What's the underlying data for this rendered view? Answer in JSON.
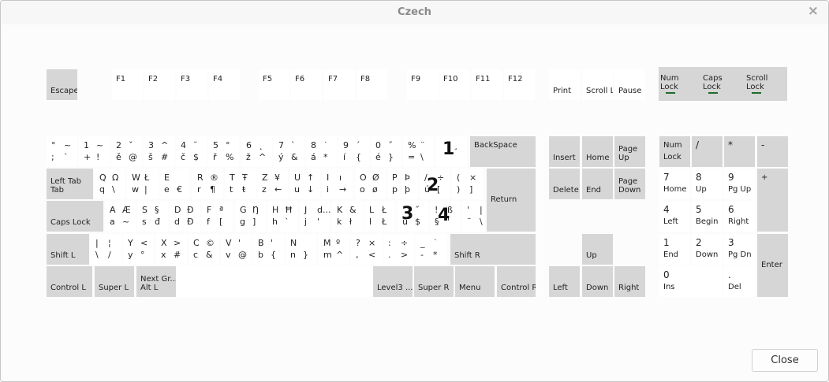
{
  "window": {
    "title": "Czech",
    "close_icon": "×",
    "close_button": "Close"
  },
  "overlay_markers": [
    "1",
    "2",
    "3",
    "4"
  ],
  "keys": [
    {
      "id": "escape",
      "label": "Escape",
      "mod": true
    },
    {
      "id": "f1",
      "label": "F1"
    },
    {
      "id": "f2",
      "label": "F2"
    },
    {
      "id": "f3",
      "label": "F3"
    },
    {
      "id": "f4",
      "label": "F4"
    },
    {
      "id": "f5",
      "label": "F5"
    },
    {
      "id": "f6",
      "label": "F6"
    },
    {
      "id": "f7",
      "label": "F7"
    },
    {
      "id": "f8",
      "label": "F8"
    },
    {
      "id": "f9",
      "label": "F9"
    },
    {
      "id": "f10",
      "label": "F10"
    },
    {
      "id": "f11",
      "label": "F11"
    },
    {
      "id": "f12",
      "label": "F12"
    },
    {
      "id": "print",
      "label": "Print"
    },
    {
      "id": "scroll-lock",
      "label": "Scroll Lock"
    },
    {
      "id": "pause",
      "label": "Pause"
    },
    {
      "id": "grave",
      "sym": [
        "°",
        "~",
        ";",
        "`"
      ]
    },
    {
      "id": "digit-1",
      "sym": [
        "1",
        "~",
        "+",
        "!"
      ]
    },
    {
      "id": "digit-2",
      "sym": [
        "2",
        "ˇ",
        "ě",
        "@"
      ]
    },
    {
      "id": "digit-3",
      "sym": [
        "3",
        "^",
        "š",
        "#"
      ]
    },
    {
      "id": "digit-4",
      "sym": [
        "4",
        "˘",
        "č",
        "$"
      ]
    },
    {
      "id": "digit-5",
      "sym": [
        "5",
        "°",
        "ř",
        "%"
      ]
    },
    {
      "id": "digit-6",
      "sym": [
        "6",
        "˛",
        "ž",
        "^"
      ]
    },
    {
      "id": "digit-7",
      "sym": [
        "7",
        "`",
        "ý",
        "&"
      ]
    },
    {
      "id": "digit-8",
      "sym": [
        "8",
        "˙",
        "á",
        "*"
      ]
    },
    {
      "id": "digit-9",
      "sym": [
        "9",
        "´",
        "í",
        "{"
      ]
    },
    {
      "id": "digit-0",
      "sym": [
        "0",
        "˝",
        "é",
        "}"
      ]
    },
    {
      "id": "minus",
      "sym": [
        "%",
        "¨",
        "=",
        "\\"
      ]
    },
    {
      "id": "equal",
      "sym": [
        "",
        "¸",
        "",
        ""
      ]
    },
    {
      "id": "backspace",
      "label": "BackSpace",
      "mod": true
    },
    {
      "id": "tab",
      "label": "Left Tab\nTab",
      "mod": true
    },
    {
      "id": "q",
      "sym": [
        "Q",
        "Ω",
        "q",
        "\\"
      ]
    },
    {
      "id": "w",
      "sym": [
        "W",
        "Ł",
        "w",
        "|"
      ]
    },
    {
      "id": "e",
      "sym": [
        "E",
        "",
        "e",
        "€"
      ]
    },
    {
      "id": "r",
      "sym": [
        "R",
        "®",
        "r",
        "¶"
      ]
    },
    {
      "id": "t",
      "sym": [
        "T",
        "Ŧ",
        "t",
        "ŧ"
      ]
    },
    {
      "id": "z",
      "sym": [
        "Z",
        "¥",
        "z",
        "←"
      ]
    },
    {
      "id": "u",
      "sym": [
        "U",
        "↑",
        "u",
        "↓"
      ]
    },
    {
      "id": "i",
      "sym": [
        "I",
        "ı",
        "i",
        "→"
      ]
    },
    {
      "id": "o",
      "sym": [
        "O",
        "Ø",
        "o",
        "ø"
      ]
    },
    {
      "id": "p",
      "sym": [
        "P",
        "Þ",
        "p",
        "þ"
      ]
    },
    {
      "id": "bracket-left",
      "sym": [
        "/",
        "÷",
        "ú",
        "["
      ]
    },
    {
      "id": "bracket-right",
      "sym": [
        "(",
        "×",
        ")",
        "]"
      ]
    },
    {
      "id": "return",
      "label": "Return",
      "mod": true
    },
    {
      "id": "caps-lock",
      "label": "Caps Lock",
      "mod": true
    },
    {
      "id": "a",
      "sym": [
        "A",
        "Æ",
        "a",
        "~"
      ]
    },
    {
      "id": "s",
      "sym": [
        "S",
        "§",
        "s",
        "đ"
      ]
    },
    {
      "id": "d",
      "sym": [
        "D",
        "Đ",
        "d",
        "Đ"
      ]
    },
    {
      "id": "f",
      "sym": [
        "F",
        "ª",
        "f",
        "["
      ]
    },
    {
      "id": "g",
      "sym": [
        "G",
        "Ŋ",
        "g",
        "]"
      ]
    },
    {
      "id": "h",
      "sym": [
        "H",
        "Ħ",
        "h",
        "`"
      ]
    },
    {
      "id": "j",
      "sym": [
        "J",
        "d...",
        "j",
        "'"
      ]
    },
    {
      "id": "k",
      "sym": [
        "K",
        "&",
        "k",
        "ł"
      ]
    },
    {
      "id": "l",
      "sym": [
        "L",
        "Ł",
        "l",
        "Ł"
      ]
    },
    {
      "id": "semicolon",
      "sym": [
        "",
        "˝",
        "ů",
        "$"
      ]
    },
    {
      "id": "quote",
      "sym": [
        "!",
        "ß",
        "§",
        "'"
      ]
    },
    {
      "id": "backslash",
      "sym": [
        "'",
        "|",
        "¨",
        "\\"
      ]
    },
    {
      "id": "shift-l",
      "label": "Shift L",
      "mod": true
    },
    {
      "id": "less",
      "sym": [
        "|",
        "¦",
        "\\",
        "/"
      ]
    },
    {
      "id": "y",
      "sym": [
        "Y",
        "<",
        "y",
        "°"
      ]
    },
    {
      "id": "x",
      "sym": [
        "X",
        ">",
        "x",
        "#"
      ]
    },
    {
      "id": "c",
      "sym": [
        "C",
        "©",
        "c",
        "&"
      ]
    },
    {
      "id": "v",
      "sym": [
        "V",
        "'",
        "v",
        "@"
      ]
    },
    {
      "id": "b",
      "sym": [
        "B",
        "'",
        "b",
        "{"
      ]
    },
    {
      "id": "n",
      "sym": [
        "N",
        "",
        "n",
        "}"
      ]
    },
    {
      "id": "m",
      "sym": [
        "M",
        "º",
        "m",
        "^"
      ]
    },
    {
      "id": "comma",
      "sym": [
        "?",
        "×",
        ",",
        "<"
      ]
    },
    {
      "id": "period",
      "sym": [
        ":",
        "÷",
        ".",
        ">"
      ]
    },
    {
      "id": "slash",
      "sym": [
        "_",
        "˙",
        "-",
        "*"
      ]
    },
    {
      "id": "shift-r",
      "label": "Shift R",
      "mod": true
    },
    {
      "id": "control-l",
      "label": "Control L",
      "mod": true
    },
    {
      "id": "super-l",
      "label": "Super L",
      "mod": true
    },
    {
      "id": "alt-l",
      "label": "Next Gr...\nAlt L",
      "mod": true
    },
    {
      "id": "space",
      "label": ""
    },
    {
      "id": "level3",
      "label": "Level3 ...",
      "mod": true
    },
    {
      "id": "super-r",
      "label": "Super R",
      "mod": true
    },
    {
      "id": "menu",
      "label": "Menu",
      "mod": true
    },
    {
      "id": "control-r",
      "label": "Control R",
      "mod": true
    },
    {
      "id": "insert",
      "label": "Insert",
      "mod": true
    },
    {
      "id": "home",
      "label": "Home",
      "mod": true
    },
    {
      "id": "page-up",
      "label": "Page\nUp",
      "mod": true
    },
    {
      "id": "delete",
      "label": "Delete",
      "mod": true
    },
    {
      "id": "end",
      "label": "End",
      "mod": true
    },
    {
      "id": "page-down",
      "label": "Page\nDown",
      "mod": true
    },
    {
      "id": "up",
      "label": "Up",
      "mod": true
    },
    {
      "id": "left",
      "label": "Left",
      "mod": true
    },
    {
      "id": "down",
      "label": "Down",
      "mod": true
    },
    {
      "id": "right",
      "label": "Right",
      "mod": true
    },
    {
      "id": "num-lock",
      "label": "Num\nLock",
      "mod": true
    },
    {
      "id": "kp-divide",
      "label": "/",
      "mod": true
    },
    {
      "id": "kp-multiply",
      "label": "*",
      "mod": true
    },
    {
      "id": "kp-minus",
      "label": "-",
      "mod": true
    },
    {
      "id": "kp-7",
      "label": "7\nHome"
    },
    {
      "id": "kp-8",
      "label": "8\nUp"
    },
    {
      "id": "kp-9",
      "label": "9\nPg Up"
    },
    {
      "id": "kp-plus",
      "label": "+",
      "mod": true
    },
    {
      "id": "kp-4",
      "label": "4\nLeft"
    },
    {
      "id": "kp-5",
      "label": "5\nBegin"
    },
    {
      "id": "kp-6",
      "label": "6\nRight"
    },
    {
      "id": "kp-1",
      "label": "1\nEnd"
    },
    {
      "id": "kp-2",
      "label": "2\nDown"
    },
    {
      "id": "kp-3",
      "label": "3\nPg Dn"
    },
    {
      "id": "kp-enter",
      "label": "Enter",
      "mod": true
    },
    {
      "id": "kp-0",
      "label": "0\nIns"
    },
    {
      "id": "kp-decimal",
      "label": ".\nDel"
    }
  ],
  "indicators": [
    {
      "id": "num-lock",
      "label": "Num\nLock"
    },
    {
      "id": "caps-lock",
      "label": "Caps\nLock"
    },
    {
      "id": "scroll-lock",
      "label": "Scroll\nLock"
    }
  ]
}
